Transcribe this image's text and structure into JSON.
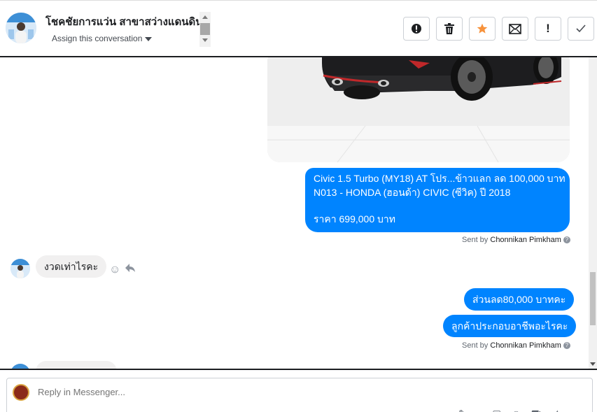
{
  "header": {
    "title": "โชคชัยการแว่น สาขาสว่างแดนดิน",
    "assign_label": "Assign this conversation",
    "actions": [
      {
        "name": "mark-spam-button",
        "icon": "alert-circle-icon",
        "glyph": "!"
      },
      {
        "name": "delete-button",
        "icon": "trash-icon",
        "glyph": "🗑"
      },
      {
        "name": "star-button",
        "icon": "star-icon",
        "glyph": "★"
      },
      {
        "name": "mark-unread-button",
        "icon": "envelope-icon",
        "glyph": "✉"
      },
      {
        "name": "report-button",
        "icon": "exclamation-icon",
        "glyph": "!"
      },
      {
        "name": "mark-done-button",
        "icon": "check-icon",
        "glyph": "✓"
      }
    ],
    "star_color": "#f7923b"
  },
  "thread": {
    "outgoing_card": {
      "line1": "Civic 1.5 Turbo (MY18) AT โปร...ข้าวแลก ลด 100,000 บาท",
      "line2": "N013 - HONDA (ฮอนด้า) CIVIC (ซีวิค) ปี 2018",
      "line3": "ราคา 699,000 บาท"
    },
    "sent_by_prefix": "Sent by",
    "sent_by_name": "Chonnikan Pimkham",
    "incoming_1": "งวดเท่าไรคะ",
    "outgoing_2": "ส่วนลด80,000 บาทคะ",
    "outgoing_3": "ลูกค้าประกอบอาชีพอะไรคะ",
    "incoming_2_partial": "…"
  },
  "composer": {
    "placeholder": "Reply in Messenger..."
  },
  "colors": {
    "bubble_out": "#0084ff",
    "bubble_in": "#f1f0f0"
  }
}
